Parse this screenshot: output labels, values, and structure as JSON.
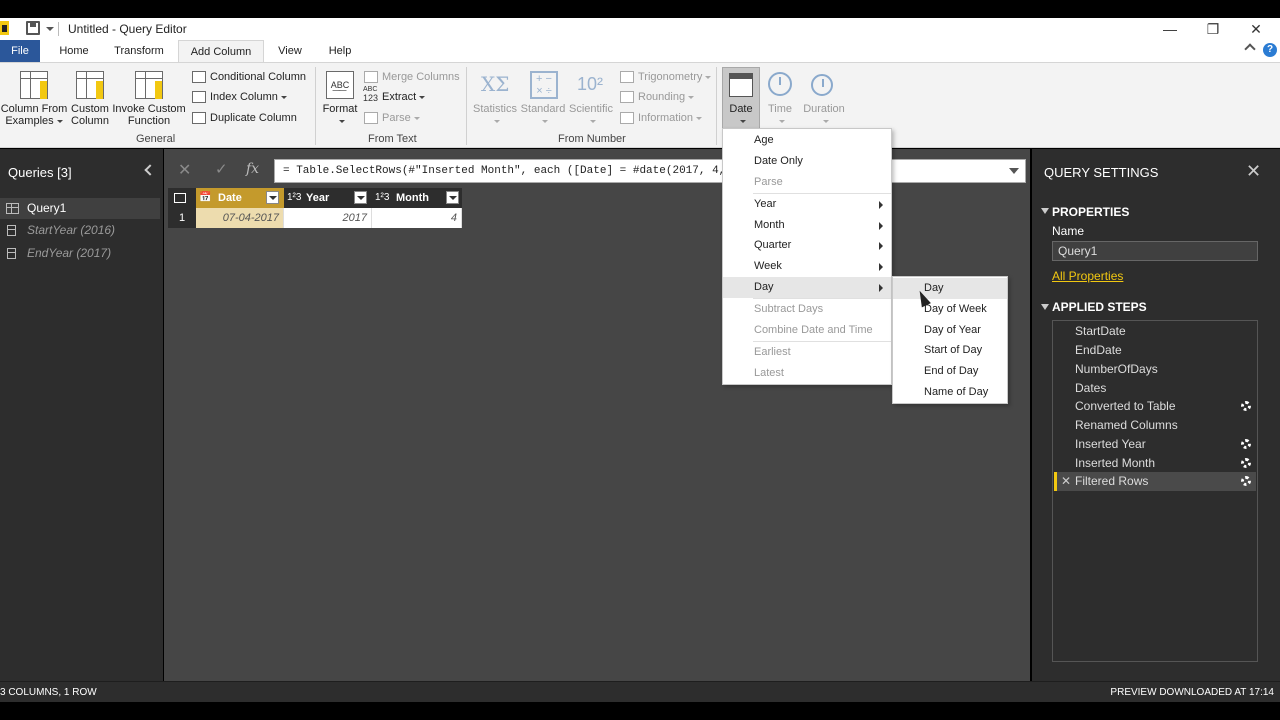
{
  "window": {
    "title": "Untitled - Query Editor",
    "minimize": "—",
    "restore": "❐",
    "close": "✕"
  },
  "ribbon_tabs": [
    "File",
    "Home",
    "Transform",
    "Add Column",
    "View",
    "Help"
  ],
  "ribbon": {
    "general": {
      "label": "General",
      "column_from_examples": [
        "Column From",
        "Examples"
      ],
      "custom_column": [
        "Custom",
        "Column"
      ],
      "invoke_custom_function": [
        "Invoke Custom",
        "Function"
      ],
      "conditional_column": "Conditional Column",
      "index_column": "Index Column",
      "duplicate_column": "Duplicate Column"
    },
    "from_text": {
      "label": "From Text",
      "format": "Format",
      "merge_columns": "Merge Columns",
      "extract": "Extract",
      "parse": "Parse",
      "abc_icon": "ABC",
      "num_icon": "123"
    },
    "from_number": {
      "label": "From Number",
      "statistics": "Statistics",
      "standard": "Standard",
      "scientific": "Scientific",
      "trigonometry": "Trigonometry",
      "rounding": "Rounding",
      "information": "Information",
      "scientific_icon": "10²"
    },
    "date_time": {
      "date": "Date",
      "time": "Time",
      "duration": "Duration"
    }
  },
  "queries_pane": {
    "title": "Queries [3]",
    "items": [
      "Query1",
      "StartYear (2016)",
      "EndYear (2017)"
    ]
  },
  "formula_bar": {
    "cancel": "✕",
    "ok": "✓",
    "fx": "fx",
    "formula": "= Table.SelectRows(#\"Inserted Month\", each ([Date] = #date(2017, 4, 7)))"
  },
  "grid": {
    "columns": [
      {
        "type": "📅",
        "name": "Date"
      },
      {
        "type": "1²3",
        "name": "Year"
      },
      {
        "type": "1²3",
        "name": "Month"
      }
    ],
    "rows": [
      {
        "num": "1",
        "cells": [
          "07-04-2017",
          "2017",
          "4"
        ]
      }
    ]
  },
  "date_menu": {
    "items": [
      "Age",
      "Date Only",
      "Parse",
      "Year",
      "Month",
      "Quarter",
      "Week",
      "Day",
      "Subtract Days",
      "Combine Date and Time",
      "Earliest",
      "Latest"
    ]
  },
  "day_submenu": {
    "items": [
      "Day",
      "Day of Week",
      "Day of Year",
      "Start of Day",
      "End of Day",
      "Name of Day"
    ]
  },
  "settings_pane": {
    "title": "QUERY SETTINGS",
    "close": "✕",
    "properties_header": "PROPERTIES",
    "name_label": "Name",
    "name_value": "Query1",
    "all_properties": "All Properties",
    "applied_steps_header": "APPLIED STEPS",
    "steps": [
      "StartDate",
      "EndDate",
      "NumberOfDays",
      "Dates",
      "Converted to Table",
      "Renamed Columns",
      "Inserted Year",
      "Inserted Month",
      "Filtered Rows"
    ],
    "step_delete": "✕"
  },
  "status": {
    "left": "3 COLUMNS, 1 ROW",
    "right": "PREVIEW DOWNLOADED AT 17:14"
  },
  "colors": {
    "accent_yellow": "#f2c811",
    "file_tab": "#2b579a",
    "pane_dark": "#2d2d2d",
    "canvas": "#464646"
  }
}
